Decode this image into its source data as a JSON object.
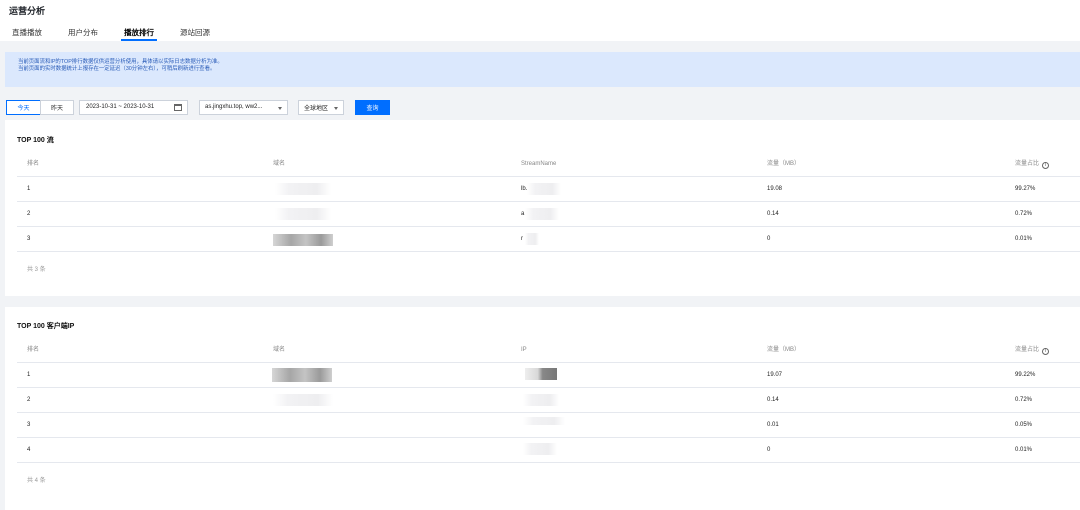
{
  "page": {
    "title": "运营分析"
  },
  "tabs": [
    {
      "label": "直播播放"
    },
    {
      "label": "用户分布"
    },
    {
      "label": "播放排行"
    },
    {
      "label": "源站回源"
    }
  ],
  "notice": {
    "line1": "当前页面流和IP的TOP排行数据仅供运营分析使用，具体请以实际日志数据分析为准。",
    "line2": "当前页面的实时数据统计上报存在一定延迟（30分钟左右），可稍后刷新进行查看。"
  },
  "filters": {
    "today": "今天",
    "yesterday": "昨天",
    "date_range": "2023-10-31  ~ 2023-10-31",
    "domain_select": "as.jingxhu.top, ww2...",
    "region_select": "全球地区",
    "query_button": "查询"
  },
  "top_streams": {
    "title": "TOP 100 流",
    "headers": {
      "rank": "排名",
      "domain": "域名",
      "stream": "StreamName",
      "traffic": "流量（MB）",
      "share": "流量占比"
    },
    "rows": [
      {
        "rank": "1",
        "stream": "lb.",
        "traffic": "19.08",
        "share": "99.27%"
      },
      {
        "rank": "2",
        "stream": "a",
        "traffic": "0.14",
        "share": "0.72%"
      },
      {
        "rank": "3",
        "stream": "r",
        "traffic": "0",
        "share": "0.01%"
      }
    ],
    "total": "共 3 条"
  },
  "top_ips": {
    "title": "TOP 100 客户端IP",
    "headers": {
      "rank": "排名",
      "domain": "域名",
      "ip": "IP",
      "traffic": "流量（MB）",
      "share": "流量占比"
    },
    "rows": [
      {
        "rank": "1",
        "traffic": "19.07",
        "share": "99.22%"
      },
      {
        "rank": "2",
        "traffic": "0.14",
        "share": "0.72%"
      },
      {
        "rank": "3",
        "traffic": "0.01",
        "share": "0.05%"
      },
      {
        "rank": "4",
        "traffic": "0",
        "share": "0.01%"
      }
    ],
    "total": "共 4 条"
  },
  "colors": {
    "accent": "#006eff",
    "notice_bg": "#dbe8fd",
    "notice_text": "#2a5cb8"
  }
}
